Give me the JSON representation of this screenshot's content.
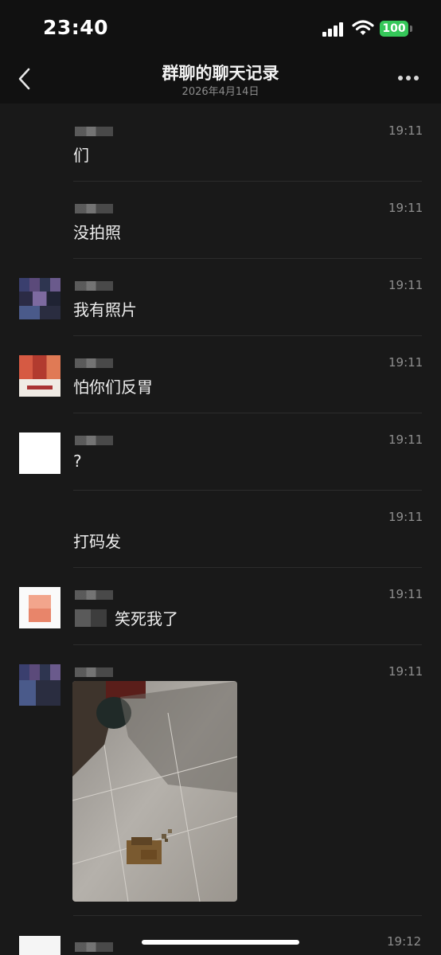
{
  "status_bar": {
    "time": "23:40",
    "battery": "100",
    "icons": [
      "signal-icon",
      "wifi-icon",
      "battery-icon"
    ]
  },
  "header": {
    "title": "群聊的聊天记录",
    "subtitle": "2026年4月14日",
    "icons": [
      "chevron-left-icon",
      "more-icon"
    ]
  },
  "messages": [
    {
      "text": "们",
      "time": "19:11"
    },
    {
      "text": "没拍照",
      "time": "19:11"
    },
    {
      "text": "我有照片",
      "time": "19:11"
    },
    {
      "text": "怕你们反胃",
      "time": "19:11"
    },
    {
      "text": "?",
      "time": "19:11"
    },
    {
      "text": "打码发",
      "time": "19:11"
    },
    {
      "text": "笑死我了",
      "time": "19:11"
    },
    {
      "text": "",
      "time": "19:11"
    },
    {
      "text": "",
      "time": "19:12"
    }
  ],
  "colors": {
    "background": "#191919",
    "header_bg": "#111111",
    "battery": "#35c759",
    "timestamp": "#8e8e8e"
  }
}
